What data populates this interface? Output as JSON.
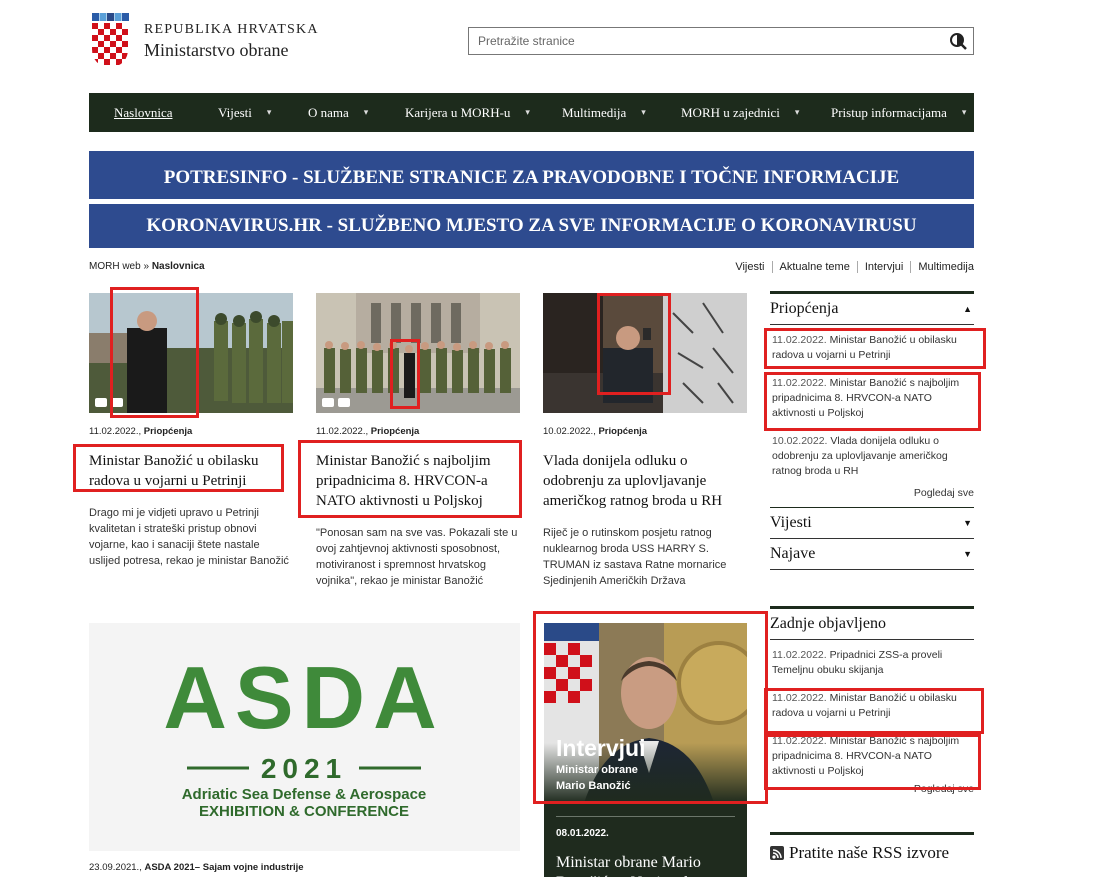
{
  "header": {
    "country": "REPUBLIKA HRVATSKA",
    "ministry": "Ministarstvo obrane",
    "search_placeholder": "Pretražite stranice"
  },
  "nav": [
    {
      "label": "Naslovnica",
      "caret": ""
    },
    {
      "label": "Vijesti",
      "caret": "▾"
    },
    {
      "label": "O nama",
      "caret": "▾"
    },
    {
      "label": "Karijera u MORH-u",
      "caret": "▾"
    },
    {
      "label": "Multimedija",
      "caret": "▾"
    },
    {
      "label": "MORH u zajednici",
      "caret": "▾"
    },
    {
      "label": "Pristup informacijama",
      "caret": "▾"
    }
  ],
  "banners": {
    "potres": "POTRESINFO - SLUŽBENE STRANICE ZA PRAVODOBNE I TOČNE INFORMACIJE",
    "korona": "KORONAVIRUS.HR -  SLUŽBENO MJESTO ZA SVE INFORMACIJE O KORONAVIRUSU"
  },
  "breadcrumb": {
    "root": "MORH web",
    "sep": " » ",
    "current": "Naslovnica"
  },
  "quicklinks": [
    "Vijesti",
    "Aktualne teme",
    "Intervjui",
    "Multimedija"
  ],
  "articles": [
    {
      "date": "11.02.2022.",
      "category": "Priopćenja",
      "title": "Ministar Banožić u obilasku radova u vojarni u Petrinji",
      "lead": "Drago mi je vidjeti upravo u Petrinji kvalitetan i strateški pristup obnovi vojarne, kao i sanaciji štete nastale uslijed potresa, rekao je ministar Banožić"
    },
    {
      "date": "11.02.2022.",
      "category": "Priopćenja",
      "title": "Ministar Banožić s najboljim pripadnicima 8. HRVCON-a NATO aktivnosti u Poljskoj",
      "lead": "\"Ponosan sam na sve vas. Pokazali ste u ovoj zahtjevnoj aktivnosti sposobnost, motiviranost i spremnost hrvatskog vojnika\", rekao je ministar Banožić"
    },
    {
      "date": "10.02.2022.",
      "category": "Priopćenja",
      "title": "Vlada donijela odluku o odobrenju za uplovljavanje američkog ratnog broda u RH",
      "lead": "Riječ je o rutinskom posjetu ratnog nuklearnog broda USS HARRY S. TRUMAN iz sastava Ratne mornarice Sjedinjenih Američkih Država"
    }
  ],
  "sidebar": {
    "priopcenja_title": "Priopćenja",
    "priopcenja": [
      {
        "date": "11.02.2022.",
        "text": "Ministar Banožić u obilasku radova u vojarni u Petrinji"
      },
      {
        "date": "11.02.2022.",
        "text": "Ministar Banožić s najboljim pripadnicima 8. HRVCON-a NATO aktivnosti u Poljskoj"
      },
      {
        "date": "10.02.2022.",
        "text": "Vlada donijela odluku o odobrenju za uplovljavanje američkog ratnog broda u RH"
      }
    ],
    "more": "Pogledaj sve",
    "vijesti": "Vijesti",
    "najave": "Najave",
    "zadnje_title": "Zadnje objavljeno",
    "zadnje": [
      {
        "date": "11.02.2022.",
        "text": "Pripadnici ZSS-a proveli Temeljnu obuku skijanja"
      },
      {
        "date": "11.02.2022.",
        "text": "Ministar Banožić u obilasku radova u vojarni u Petrinji"
      },
      {
        "date": "11.02.2022.",
        "text": "Ministar Banožić s najboljim pripadnicima 8. HRVCON-a NATO aktivnosti u Poljskoj"
      }
    ],
    "rss": "Pratite naše RSS izvore"
  },
  "asda": {
    "logo": "ASDA",
    "year": "2021",
    "line1": "Adriatic Sea Defense & Aerospace",
    "line2": "EXHIBITION  &  CONFERENCE",
    "caption_date": "23.09.2021.",
    "caption_text": "ASDA 2021– Sajam vojne industrije"
  },
  "interview": {
    "heading": "Intervjui",
    "sub1": "Ministar obrane",
    "sub2": "Mario Banožić",
    "date": "08.01.2022.",
    "title": "Ministar obrane Mario Banožić za Nacional"
  },
  "colors": {
    "nav": "#1d2b1c",
    "banner": "#2e4b8f",
    "highlight": "#e02020",
    "asda_green": "#3f8a3a"
  }
}
